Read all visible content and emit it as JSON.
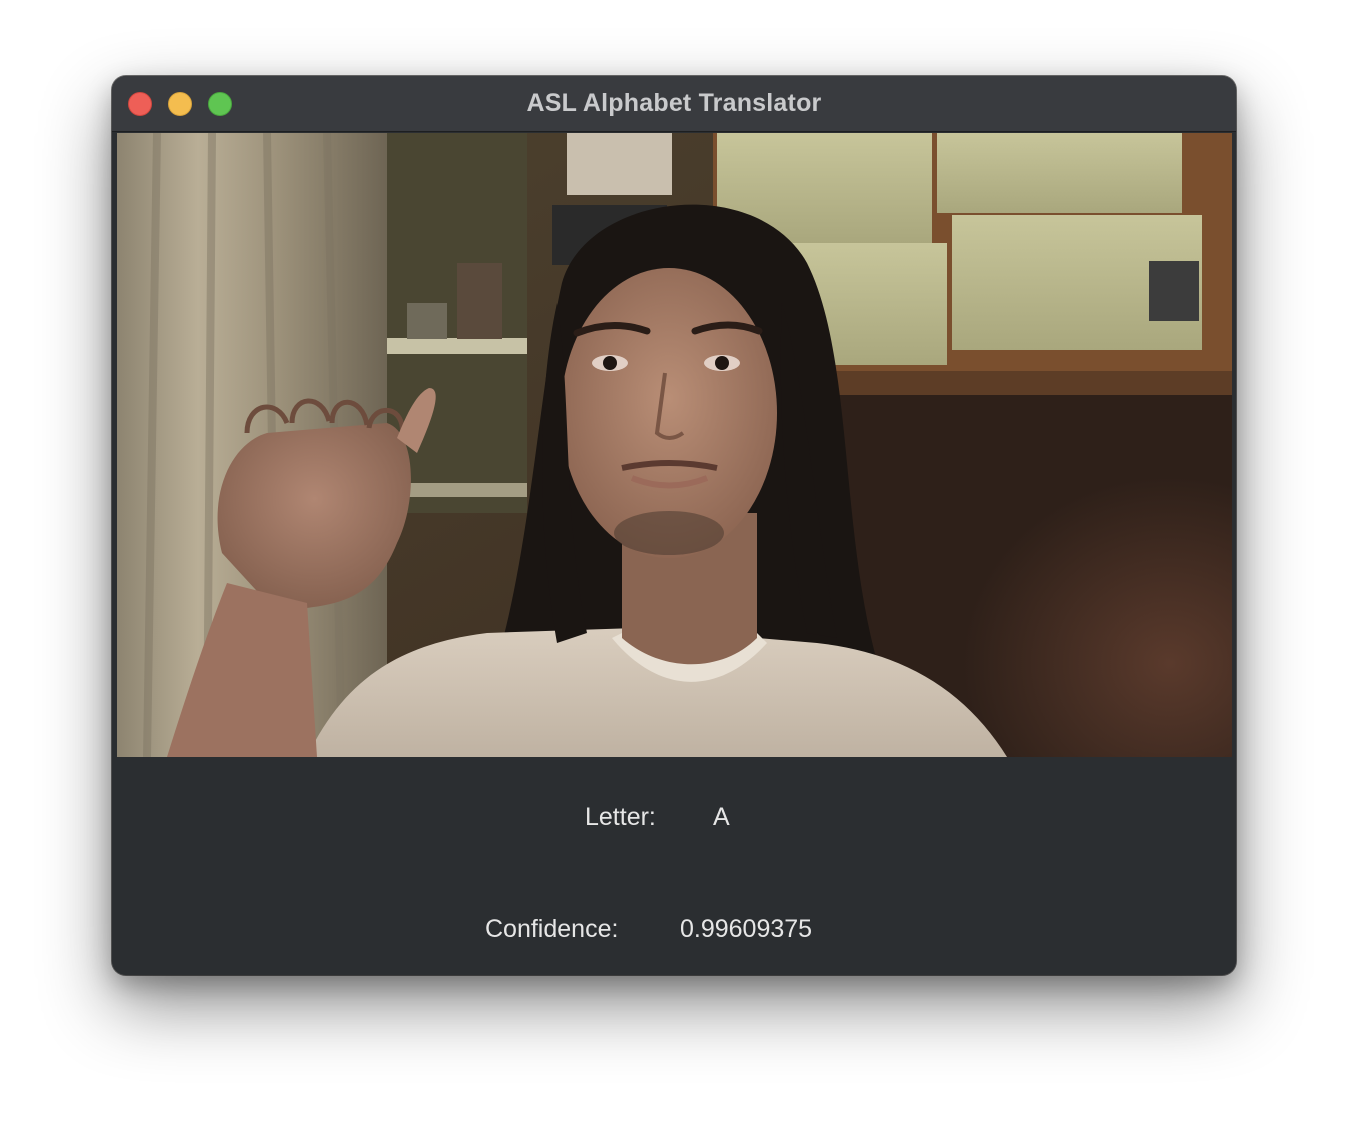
{
  "window": {
    "title": "ASL Alphabet Translator"
  },
  "camera_feed": {
    "description_icon": "webcam-video-frame"
  },
  "prediction": {
    "letter_label": "Letter:",
    "letter_value": "A",
    "confidence_label": "Confidence:",
    "confidence_value": "0.99609375"
  },
  "colors": {
    "titlebar": "#393b3f",
    "body": "#2b2e31",
    "close": "#ee5f57",
    "minimize": "#f4bd4f",
    "maximize": "#5fc552",
    "text": "#e6e6e6"
  }
}
